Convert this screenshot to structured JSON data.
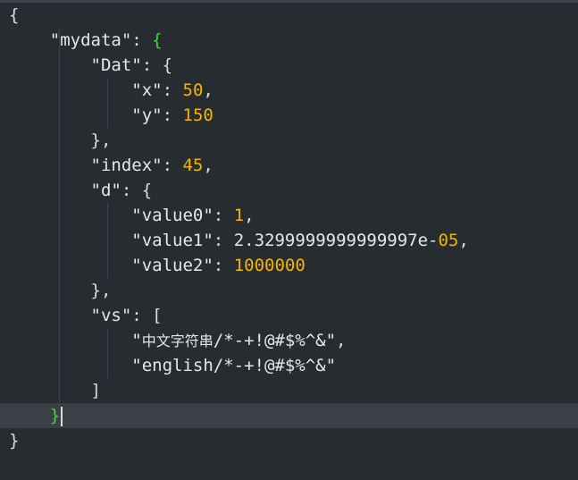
{
  "editor": {
    "line1_open": "{",
    "mydata_key": "\"mydata\"",
    "dat_key": "\"Dat\"",
    "x_key": "\"x\"",
    "x_val": "50",
    "y_key": "\"y\"",
    "y_val": "150",
    "index_key": "\"index\"",
    "index_val": "45",
    "d_key": "\"d\"",
    "value0_key": "\"value0\"",
    "value0_val": "1",
    "value1_key": "\"value1\"",
    "value1_val_mantissa": "2.3299999999999997e-",
    "value1_val_exp": "05",
    "value2_key": "\"value2\"",
    "value2_val": "1000000",
    "vs_key": "\"vs\"",
    "vs_item1_cjk": "中文字符串",
    "vs_item1_rest": "/*-+!@#$%^&\"",
    "vs_item2": "\"english/*-+!@#$%^&\"",
    "close_bracket": "]",
    "close_mydata": "}",
    "close_root": "}"
  },
  "colors": {
    "background": "#272c30",
    "number": "#f4b400",
    "text": "#e4e8ea",
    "matched_brace": "#30e030",
    "active_line": "#3a4045"
  }
}
